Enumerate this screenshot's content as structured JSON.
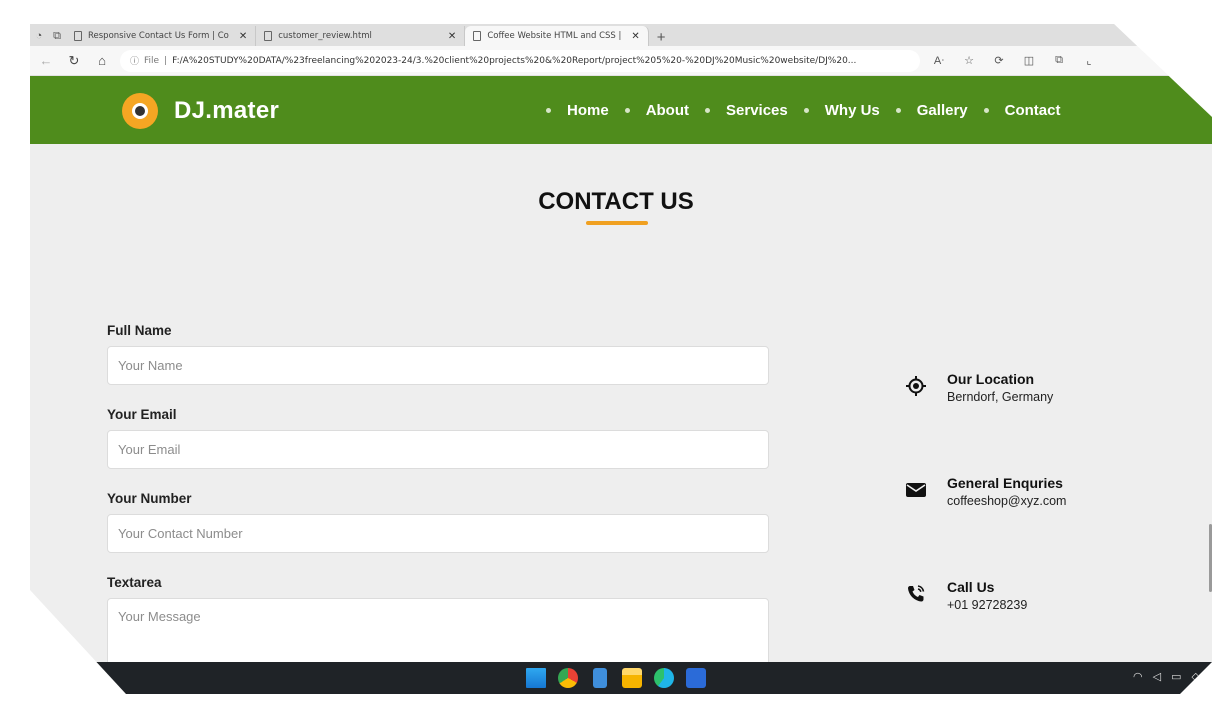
{
  "browser": {
    "tabs": [
      {
        "label": "Responsive Contact Us Form | Co",
        "active": false
      },
      {
        "label": "customer_review.html",
        "active": false
      },
      {
        "label": "Coffee Website HTML and CSS |",
        "active": true
      }
    ],
    "new_tab_label": "+",
    "address": {
      "info_label": "File",
      "url": "F:/A%20STUDY%20DATA/%23freelancing%202023-24/3.%20client%20projects%20&%20Report/project%205%20-%20DJ%20Music%20website/DJ%20..."
    },
    "icons": [
      "back-icon",
      "reload-icon",
      "home-icon",
      "info-icon",
      "read-aloud-icon",
      "favorite-icon",
      "extensions-icon",
      "split-screen-icon",
      "collections-icon"
    ]
  },
  "site": {
    "brand": "DJ.mater",
    "nav": [
      "Home",
      "About",
      "Services",
      "Why Us",
      "Gallery",
      "Contact"
    ],
    "colors": {
      "header": "#4f8c1c",
      "accent": "#f0a020",
      "page_bg": "#eeeeee"
    }
  },
  "contact": {
    "title": "CONTACT US",
    "form": {
      "full_name_label": "Full Name",
      "full_name_placeholder": "Your Name",
      "email_label": "Your Email",
      "email_placeholder": "Your Email",
      "number_label": "Your Number",
      "number_placeholder": "Your Contact Number",
      "textarea_label": "Textarea",
      "textarea_placeholder": "Your Message"
    },
    "info": [
      {
        "icon": "location-target-icon",
        "title": "Our Location",
        "text": "Berndorf, Germany"
      },
      {
        "icon": "mail-icon",
        "title": "General Enquries",
        "text": "coffeeshop@xyz.com"
      },
      {
        "icon": "phone-icon",
        "title": "Call Us",
        "text": "+01 92728239"
      }
    ]
  },
  "taskbar": {
    "apps": [
      "windows-start-icon",
      "chrome-icon",
      "notepad-icon",
      "file-explorer-icon",
      "edge-icon",
      "word-icon"
    ],
    "tray": [
      "wifi-icon",
      "volume-icon",
      "battery-icon",
      "notification-icon"
    ]
  }
}
